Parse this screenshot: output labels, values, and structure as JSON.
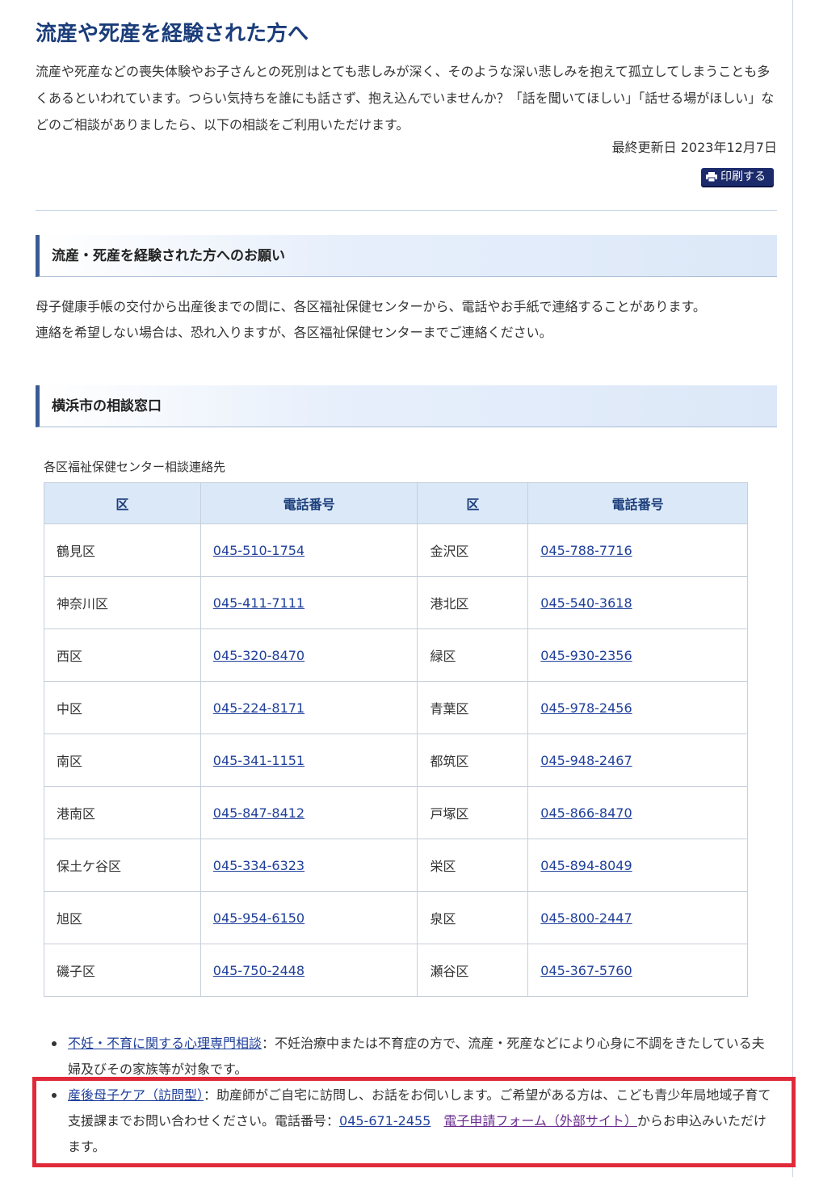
{
  "page": {
    "title": "流産や死産を経験された方へ",
    "intro": "流産や死産などの喪失体験やお子さんとの死別はとても悲しみが深く、そのような深い悲しみを抱えて孤立してしまうことも多くあるといわれています。つらい気持ちを誰にも話さず、抱え込んでいませんか？「話を聞いてほしい」「話せる場がほしい」などのご相談がありましたら、以下の相談をご利用いただけます。",
    "updated": "最終更新日 2023年12月7日",
    "print_label": "印刷する"
  },
  "section1": {
    "heading": "流産・死産を経験された方へのお願い",
    "text_line1": "母子健康手帳の交付から出産後までの間に、各区福祉保健センターから、電話やお手紙で連絡することがあります。",
    "text_line2": "連絡を希望しない場合は、恐れ入りますが、各区福祉保健センターまでご連絡ください。"
  },
  "section2": {
    "heading": "横浜市の相談窓口",
    "caption": "各区福祉保健センター相談連絡先",
    "headers": [
      "区",
      "電話番号",
      "区",
      "電話番号"
    ],
    "rows": [
      [
        "鶴見区",
        "045-510-1754",
        "金沢区",
        "045-788-7716"
      ],
      [
        "神奈川区",
        "045-411-7111",
        "港北区",
        "045-540-3618"
      ],
      [
        "西区",
        "045-320-8470",
        "緑区",
        "045-930-2356"
      ],
      [
        "中区",
        "045-224-8171",
        "青葉区",
        "045-978-2456"
      ],
      [
        "南区",
        "045-341-1151",
        "都筑区",
        "045-948-2467"
      ],
      [
        "港南区",
        "045-847-8412",
        "戸塚区",
        "045-866-8470"
      ],
      [
        "保土ケ谷区",
        "045-334-6323",
        "栄区",
        "045-894-8049"
      ],
      [
        "旭区",
        "045-954-6150",
        "泉区",
        "045-800-2447"
      ],
      [
        "磯子区",
        "045-750-2448",
        "瀬谷区",
        "045-367-5760"
      ]
    ]
  },
  "notes": {
    "item1_link": "不妊・不育に関する心理専門相談",
    "item1_text": "：不妊治療中または不育症の方で、流産・死産などにより心身に不調をきたしている夫婦及びその家族等が対象です。",
    "item2_link": "産後母子ケア（訪問型）",
    "item2_text": "：助産師がご自宅に訪問し、お話をお伺いします。ご希望がある方は、こども青少年局地域子育て支援課までお問い合わせください。電話番号：",
    "item2_phone": "045-671-2455",
    "item2_form": "電子申請フォーム（外部サイト）",
    "item2_tail": "からお申込みいただけます。"
  },
  "colors": {
    "title": "#1b3d7a",
    "link": "#1f3f9a",
    "visited_link": "#6a2c8e",
    "highlight": "#e02a3a",
    "table_header_bg": "#dbe8f8"
  }
}
